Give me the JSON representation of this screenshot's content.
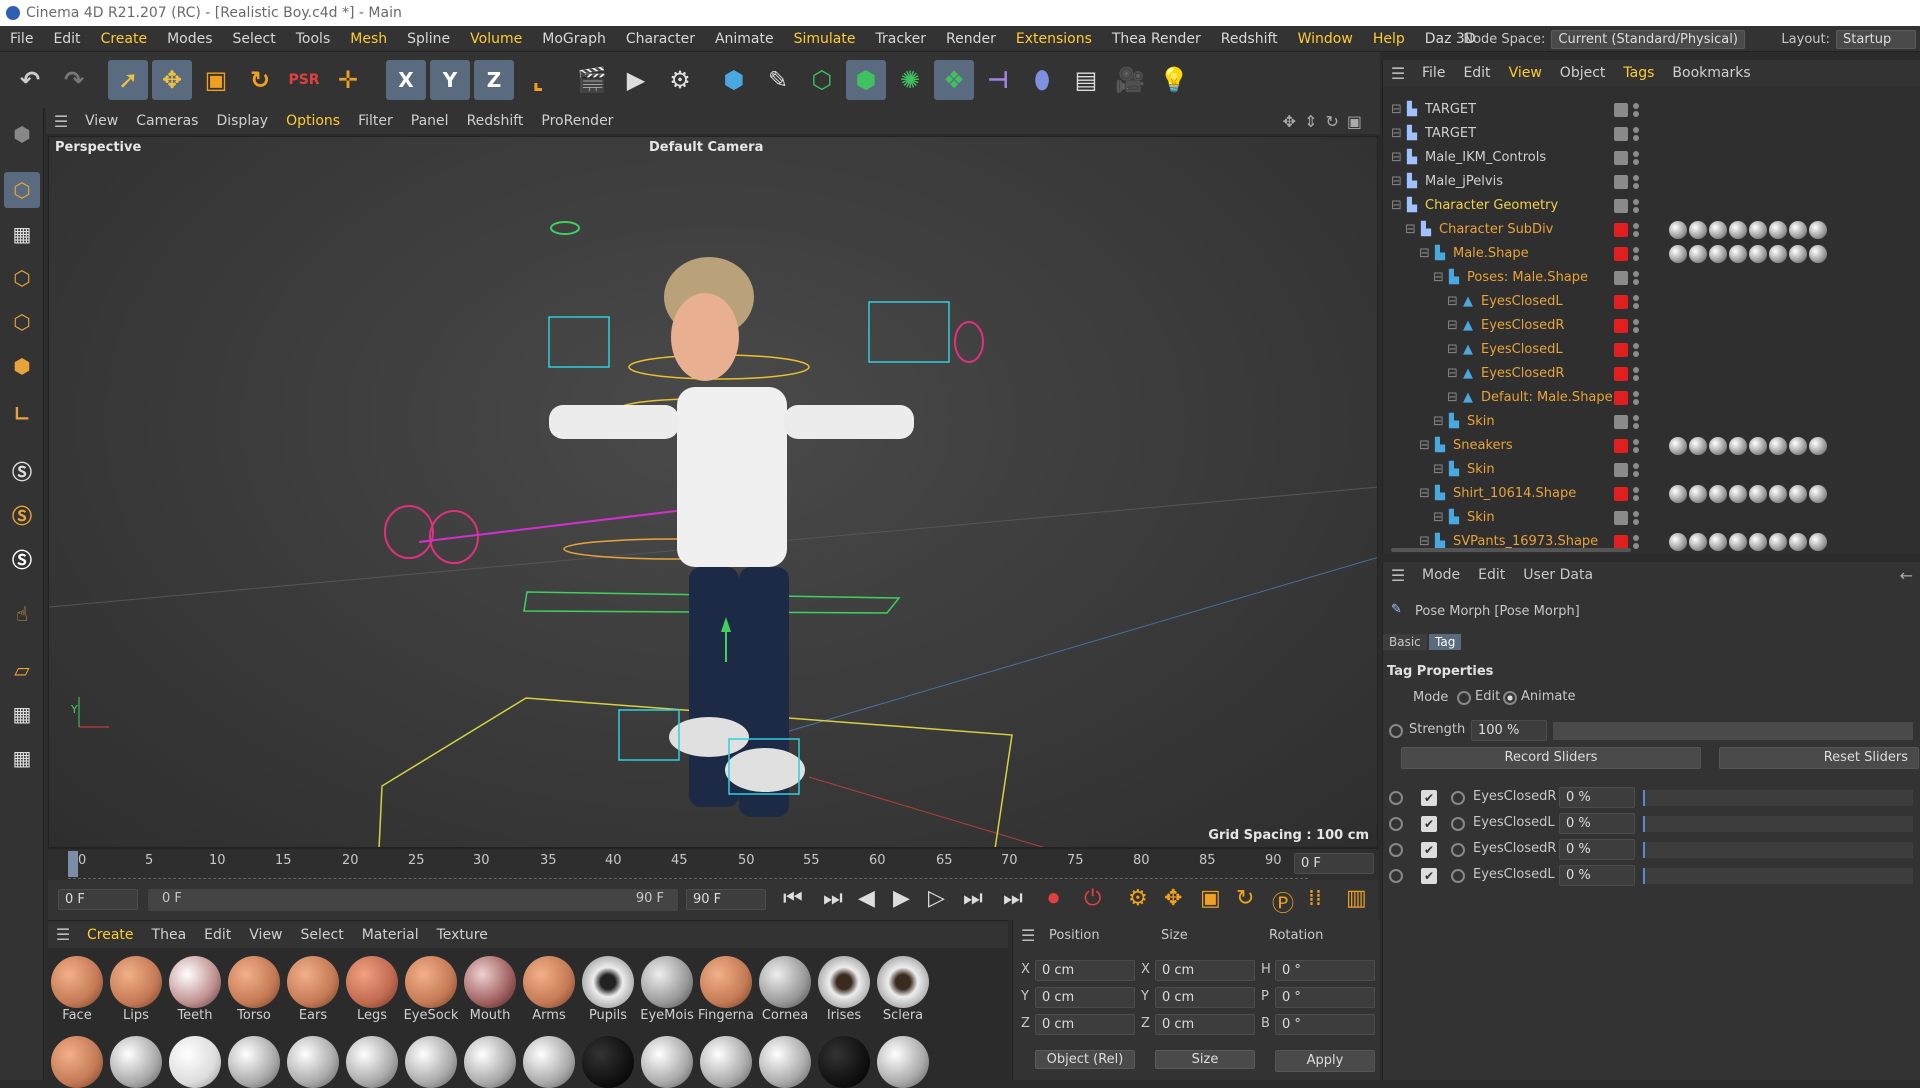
{
  "window": {
    "title": "Cinema 4D R21.207 (RC) - [Realistic Boy.c4d *] - Main"
  },
  "menubar": {
    "items": [
      "File",
      "Edit",
      "Create",
      "Modes",
      "Select",
      "Tools",
      "Mesh",
      "Spline",
      "Volume",
      "MoGraph",
      "Character",
      "Animate",
      "Simulate",
      "Tracker",
      "Render",
      "Extensions",
      "Thea Render",
      "Redshift",
      "Window",
      "Help",
      "Daz 3D"
    ],
    "node_space_label": "Node Space:",
    "node_space_value": "Current (Standard/Physical)",
    "layout_label": "Layout:",
    "layout_value": "Startup"
  },
  "toolbar": {
    "axis_x": "X",
    "axis_y": "Y",
    "axis_z": "Z"
  },
  "viewport_menu": {
    "items": [
      "View",
      "Cameras",
      "Display",
      "Options",
      "Filter",
      "Panel",
      "Redshift",
      "ProRender"
    ]
  },
  "viewport": {
    "label": "Perspective",
    "camera": "Default Camera",
    "grid_spacing": "Grid Spacing : 100 cm"
  },
  "timeline": {
    "ticks": [
      "0",
      "5",
      "10",
      "15",
      "20",
      "25",
      "30",
      "35",
      "40",
      "45",
      "50",
      "55",
      "60",
      "65",
      "70",
      "75",
      "80",
      "85",
      "90"
    ],
    "current_frame": "0 F"
  },
  "transport": {
    "start": "0 F",
    "range_start": "0 F",
    "range_end": "90 F",
    "end": "90 F"
  },
  "material_menu": {
    "items": [
      "Create",
      "Thea",
      "Edit",
      "View",
      "Select",
      "Material",
      "Texture"
    ]
  },
  "materials": {
    "row1": [
      "Face",
      "Lips",
      "Teeth",
      "Torso",
      "Ears",
      "Legs",
      "EyeSock",
      "Mouth",
      "Arms",
      "Pupils",
      "EyeMois",
      "Fingerna",
      "Cornea",
      "Irises",
      "Sclera"
    ]
  },
  "coords": {
    "headers": [
      "Position",
      "Size",
      "Rotation"
    ],
    "rows": [
      {
        "a": "X",
        "pos": "0 cm",
        "b": "X",
        "size": "0 cm",
        "c": "H",
        "rot": "0 °"
      },
      {
        "a": "Y",
        "pos": "0 cm",
        "b": "Y",
        "size": "0 cm",
        "c": "P",
        "rot": "0 °"
      },
      {
        "a": "Z",
        "pos": "0 cm",
        "b": "Z",
        "size": "0 cm",
        "c": "B",
        "rot": "0 °"
      }
    ],
    "mode1": "Object (Rel)",
    "mode2": "Size",
    "apply": "Apply"
  },
  "object_manager": {
    "menu": [
      "File",
      "Edit",
      "View",
      "Object",
      "Tags",
      "Bookmarks"
    ],
    "rows": [
      {
        "name": "TARGET",
        "indent": 0,
        "color": "#d0d0d0"
      },
      {
        "name": "TARGET",
        "indent": 0,
        "color": "#d0d0d0"
      },
      {
        "name": "Male_IKM_Controls",
        "indent": 0,
        "color": "#d0d0d0"
      },
      {
        "name": "Male_jPelvis",
        "indent": 0,
        "color": "#d0d0d0"
      },
      {
        "name": "Character Geometry",
        "indent": 0,
        "color": "#f2d24a"
      },
      {
        "name": "Character SubDiv",
        "indent": 1,
        "color": "#e8a33a"
      },
      {
        "name": "Male.Shape",
        "indent": 2,
        "color": "#e8a33a"
      },
      {
        "name": "Poses: Male.Shape",
        "indent": 3,
        "color": "#e8a33a"
      },
      {
        "name": "EyesClosedL",
        "indent": 4,
        "color": "#e8a33a"
      },
      {
        "name": "EyesClosedR",
        "indent": 4,
        "color": "#e8a33a"
      },
      {
        "name": "EyesClosedL",
        "indent": 4,
        "color": "#e8a33a"
      },
      {
        "name": "EyesClosedR",
        "indent": 4,
        "color": "#e8a33a"
      },
      {
        "name": "Default: Male.Shape",
        "indent": 4,
        "color": "#e8a33a"
      },
      {
        "name": "Skin",
        "indent": 3,
        "color": "#e8a33a"
      },
      {
        "name": "Sneakers",
        "indent": 2,
        "color": "#e8a33a"
      },
      {
        "name": "Skin",
        "indent": 3,
        "color": "#e8a33a"
      },
      {
        "name": "Shirt_10614.Shape",
        "indent": 2,
        "color": "#e8a33a"
      },
      {
        "name": "Skin",
        "indent": 3,
        "color": "#e8a33a"
      },
      {
        "name": "SVPants_16973.Shape",
        "indent": 2,
        "color": "#e8a33a"
      }
    ]
  },
  "attributes": {
    "menu": [
      "Mode",
      "Edit",
      "User Data"
    ],
    "object_title": "Pose Morph [Pose Morph]",
    "tabs": [
      "Basic",
      "Tag"
    ],
    "section": "Tag Properties",
    "mode_label": "Mode",
    "mode_edit": "Edit",
    "mode_animate": "Animate",
    "strength_label": "Strength",
    "strength_value": "100 %",
    "record_sliders": "Record Sliders",
    "reset_sliders": "Reset Sliders",
    "sliders": [
      {
        "name": "EyesClosedR",
        "value": "0 %"
      },
      {
        "name": "EyesClosedL",
        "value": "0 %"
      },
      {
        "name": "EyesClosedR",
        "value": "0 %"
      },
      {
        "name": "EyesClosedL",
        "value": "0 %"
      }
    ]
  }
}
